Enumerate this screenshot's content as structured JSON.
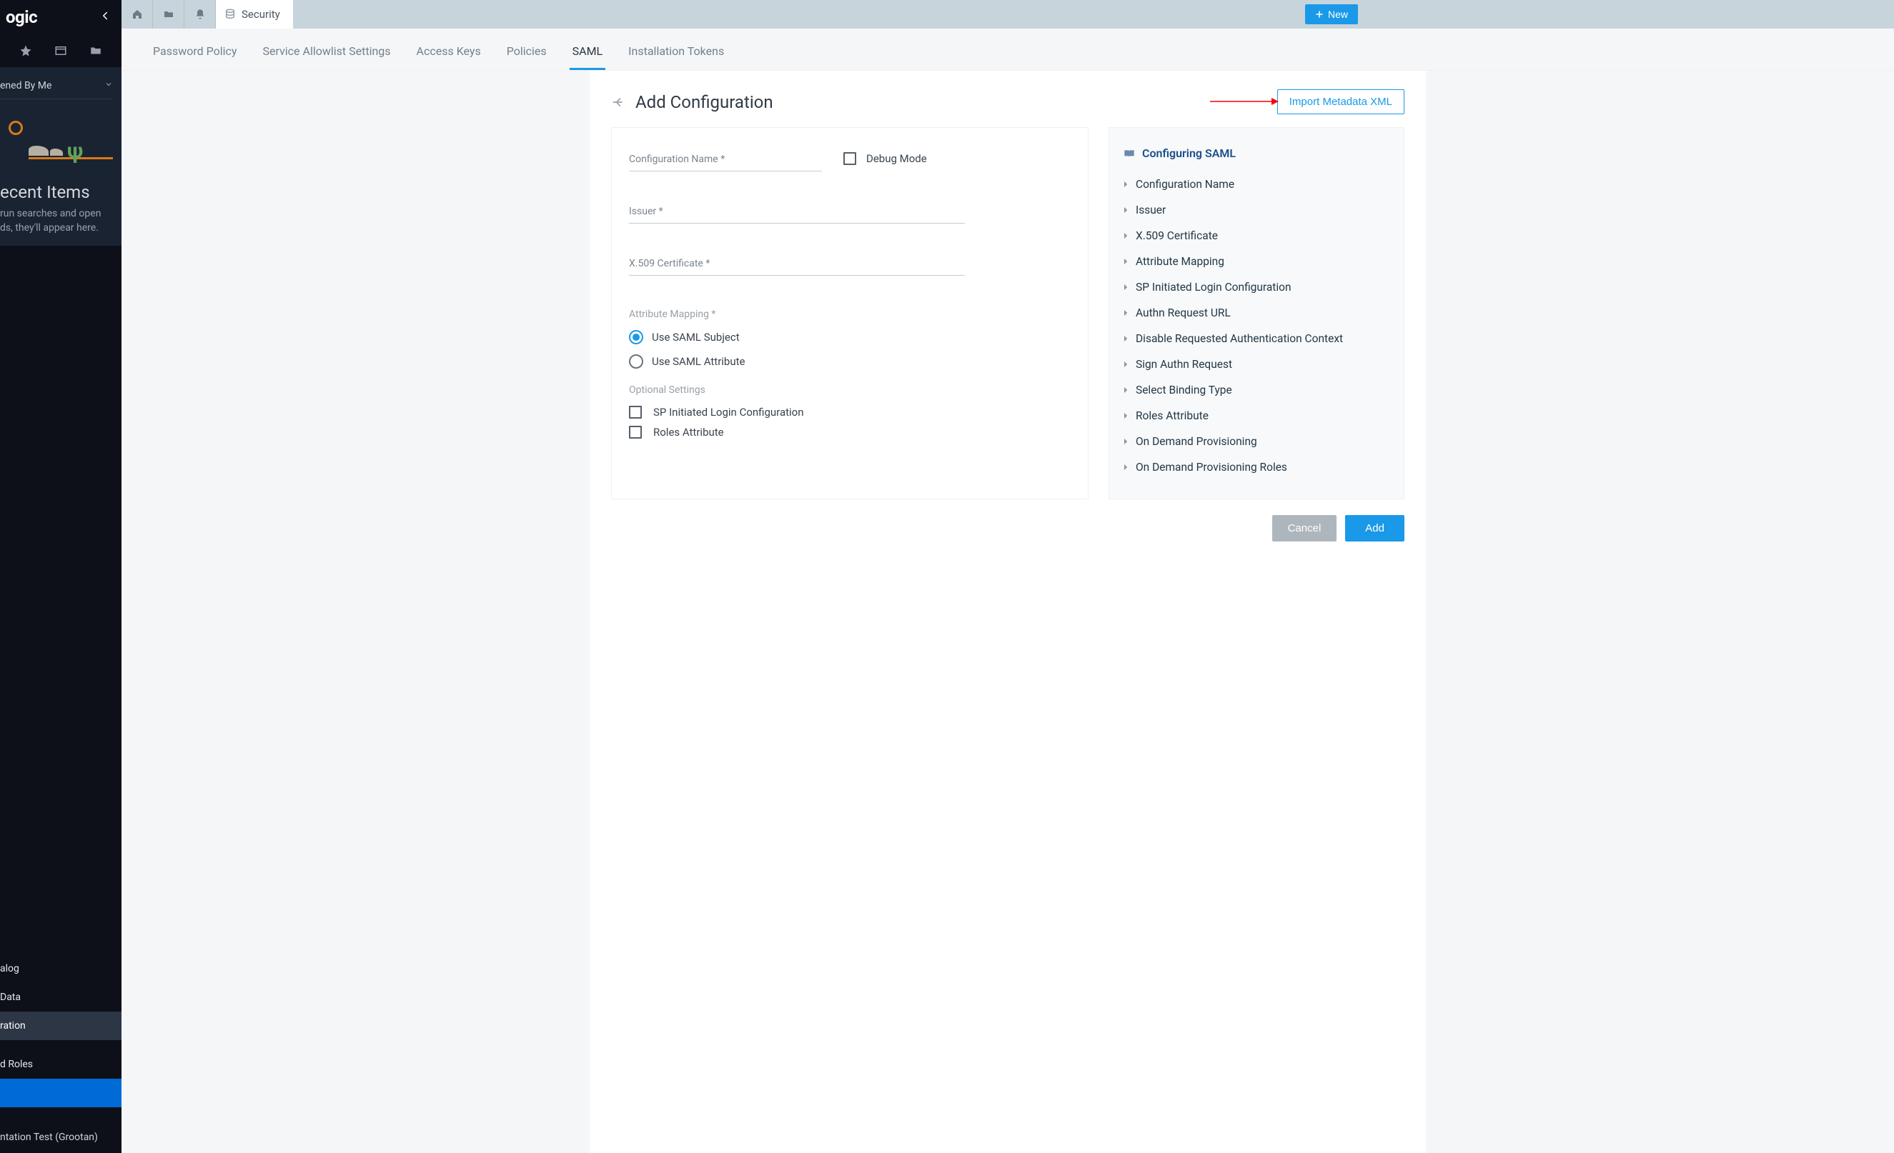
{
  "brand_fragment": "ogic",
  "sidebar": {
    "opened_by_me": "ened By Me",
    "recent_title": "ecent Items",
    "recent_sub": "run searches and open\nds, they'll appear here.",
    "nav": {
      "catalog": "alog",
      "data": "Data",
      "admin": "ration",
      "roles": "d Roles",
      "footer": "ntation Test (Grootan)"
    }
  },
  "topbar": {
    "security_tab": "Security",
    "new_button": "New"
  },
  "subtabs": [
    "Password Policy",
    "Service Allowlist Settings",
    "Access Keys",
    "Policies",
    "SAML",
    "Installation Tokens"
  ],
  "page": {
    "title": "Add Configuration",
    "import_btn": "Import Metadata XML",
    "fields": {
      "config_name": "Configuration Name *",
      "debug_mode": "Debug Mode",
      "issuer": "Issuer *",
      "x509": "X.509 Certificate *",
      "attr_mapping": "Attribute Mapping *",
      "use_subject": "Use SAML Subject",
      "use_attribute": "Use SAML Attribute",
      "optional_settings": "Optional Settings",
      "sp_initiated": "SP Initiated Login Configuration",
      "roles_attr": "Roles Attribute"
    },
    "help": {
      "title": "Configuring SAML",
      "items": [
        "Configuration Name",
        "Issuer",
        "X.509 Certificate",
        "Attribute Mapping",
        "SP Initiated Login Configuration",
        "Authn Request URL",
        "Disable Requested Authentication Context",
        "Sign Authn Request",
        "Select Binding Type",
        "Roles Attribute",
        "On Demand Provisioning",
        "On Demand Provisioning Roles"
      ]
    },
    "actions": {
      "cancel": "Cancel",
      "add": "Add"
    }
  }
}
